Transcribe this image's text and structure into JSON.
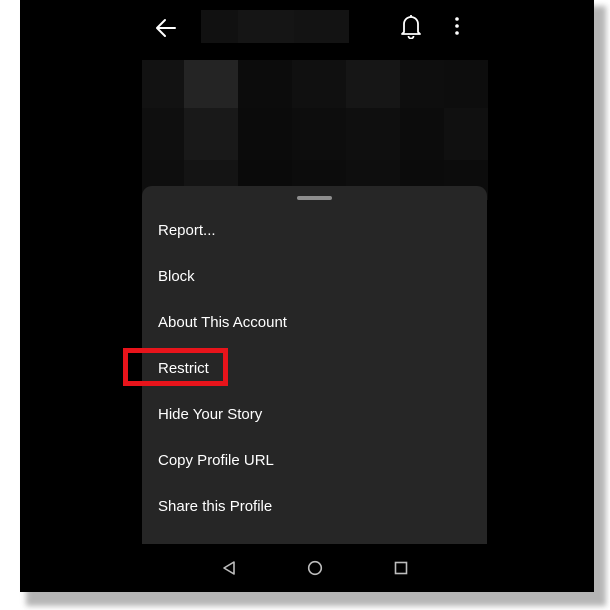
{
  "top_bar": {
    "back_icon": "arrow-left-icon",
    "bell_icon": "bell-icon",
    "more_icon": "more-vertical-icon"
  },
  "sheet": {
    "menu_items": [
      {
        "label": "Report..."
      },
      {
        "label": "Block"
      },
      {
        "label": "About This Account"
      },
      {
        "label": "Restrict"
      },
      {
        "label": "Hide Your Story"
      },
      {
        "label": "Copy Profile URL"
      },
      {
        "label": "Share this Profile"
      }
    ]
  },
  "annotation": {
    "highlighted_item": "Restrict",
    "color": "#e8141b"
  },
  "nav_bar": {
    "back_icon": "nav-back-triangle-icon",
    "home_icon": "nav-home-circle-icon",
    "recents_icon": "nav-recents-square-icon"
  },
  "colors": {
    "background": "#000000",
    "sheet": "#262626",
    "text": "#ffffff",
    "handle": "#8e8e8e"
  }
}
